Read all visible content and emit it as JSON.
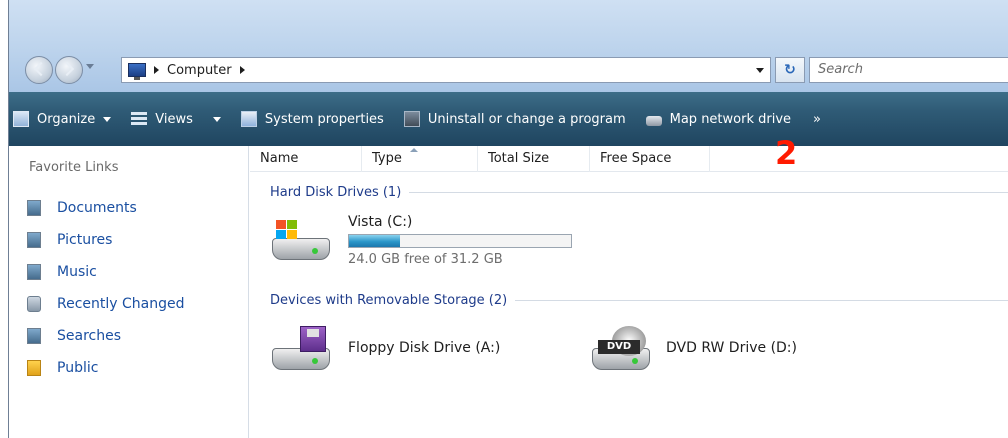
{
  "address": {
    "breadcrumbs": [
      "Computer"
    ],
    "search_placeholder": "Search"
  },
  "toolbar": {
    "organize_label": "Organize",
    "views_label": "Views",
    "system_properties_label": "System properties",
    "uninstall_label": "Uninstall or change a program",
    "map_drive_label": "Map network drive",
    "more_label": "»"
  },
  "annotation": "2",
  "sidebar": {
    "title": "Favorite Links",
    "items": [
      {
        "label": "Documents",
        "icon": "documents-icon"
      },
      {
        "label": "Pictures",
        "icon": "pictures-icon"
      },
      {
        "label": "Music",
        "icon": "music-icon"
      },
      {
        "label": "Recently Changed",
        "icon": "recently-changed-icon"
      },
      {
        "label": "Searches",
        "icon": "searches-icon"
      },
      {
        "label": "Public",
        "icon": "public-folder-icon"
      }
    ]
  },
  "columns": [
    "Name",
    "Type",
    "Total Size",
    "Free Space"
  ],
  "groups": {
    "hard_disks": {
      "label": "Hard Disk Drives (1)",
      "drives": [
        {
          "name": "Vista (C:)",
          "free_text": "24.0 GB free of 31.2 GB",
          "used_fraction": 0.23
        }
      ]
    },
    "removable": {
      "label": "Devices with Removable Storage (2)",
      "drives": [
        {
          "name": "Floppy Disk Drive (A:)",
          "icon": "floppy-drive-icon"
        },
        {
          "name": "DVD RW Drive (D:)",
          "icon": "dvd-drive-icon",
          "badge": "DVD"
        }
      ]
    }
  },
  "colors": {
    "command_bar": "#2f5b76",
    "link": "#1a4fa1",
    "group_header": "#1e3b8a",
    "annotation": "#ff1a00"
  }
}
